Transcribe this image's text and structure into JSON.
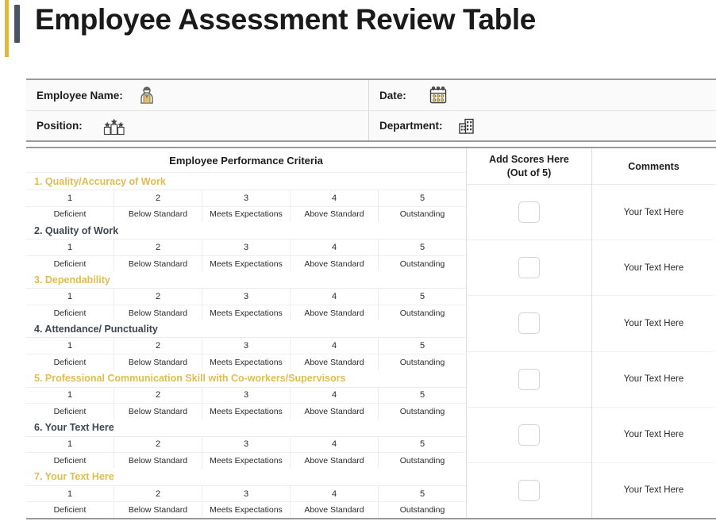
{
  "page": {
    "title": "Employee Assessment Review Table",
    "accent_gold": "#e2b93b",
    "accent_slate": "#4a5563"
  },
  "info": {
    "rows": [
      {
        "left_label": "Employee Name:",
        "left_icon": "person-employee-icon",
        "right_label": "Date:",
        "right_icon": "calendar-icon"
      },
      {
        "left_label": "Position:",
        "left_icon": "podium-ranking-icon",
        "right_label": "Department:",
        "right_icon": "office-building-icon"
      }
    ]
  },
  "table": {
    "headers": {
      "criteria": "Employee Performance Criteria",
      "scores_line1": "Add Scores Here",
      "scores_line2": "(Out of 5)",
      "comments": "Comments"
    },
    "scale": {
      "numbers": [
        "1",
        "2",
        "3",
        "4",
        "5"
      ],
      "labels": [
        "Deficient",
        "Below Standard",
        "Meets Expectations",
        "Above Standard",
        "Outstanding"
      ]
    },
    "criteria": [
      {
        "title": "1. Quality/Accuracy of Work",
        "color": "gold"
      },
      {
        "title": "2. Quality of Work",
        "color": "slate"
      },
      {
        "title": "3. Dependability",
        "color": "gold"
      },
      {
        "title": "4. Attendance/ Punctuality",
        "color": "slate"
      },
      {
        "title": "5. Professional Communication Skill with Co-workers/Supervisors",
        "color": "gold"
      },
      {
        "title": "6. Your Text Here",
        "color": "slate"
      },
      {
        "title": "7. Your Text Here",
        "color": "gold"
      }
    ],
    "score_rows": [
      "",
      "",
      "",
      "",
      "",
      ""
    ],
    "comments": [
      "Your Text Here",
      "Your Text Here",
      "Your Text Here",
      "Your Text Here",
      "Your Text Here",
      "Your Text Here"
    ]
  }
}
